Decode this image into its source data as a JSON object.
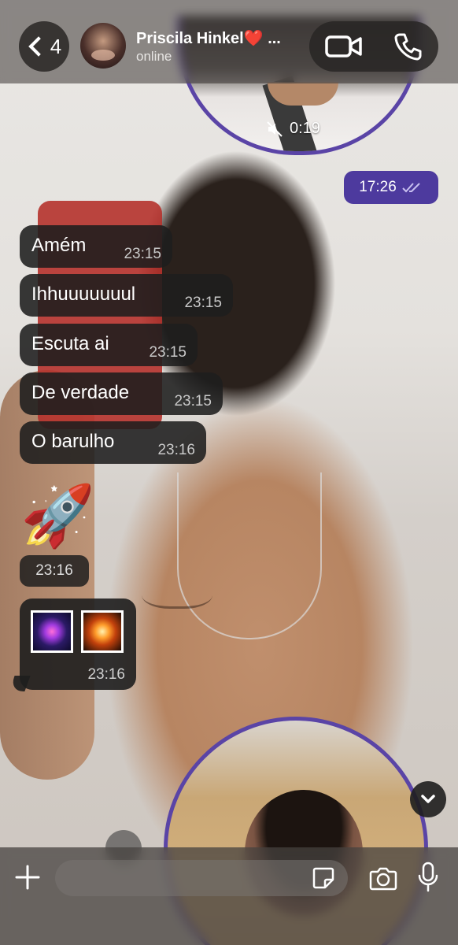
{
  "header": {
    "back_count": "4",
    "contact_name": "Priscila Hinkel❤️ ...",
    "status": "online"
  },
  "video_message_top": {
    "duration": "0:19"
  },
  "outgoing_time": "17:26",
  "messages": [
    {
      "text": "Amém",
      "time": "23:15"
    },
    {
      "text": "Ihhuuuuuuul",
      "time": "23:15"
    },
    {
      "text": "Escuta ai",
      "time": "23:15"
    },
    {
      "text": "De verdade",
      "time": "23:15"
    },
    {
      "text": "O barulho",
      "time": "23:16"
    }
  ],
  "emoji_message": {
    "emoji": "🚀",
    "time": "23:16"
  },
  "sticker_message": {
    "time": "23:16"
  },
  "input": {
    "placeholder": ""
  },
  "colors": {
    "accent": "#5a44a6",
    "outgoing_bubble": "#4d3a9e",
    "incoming_bubble": "#1e1e1e"
  }
}
